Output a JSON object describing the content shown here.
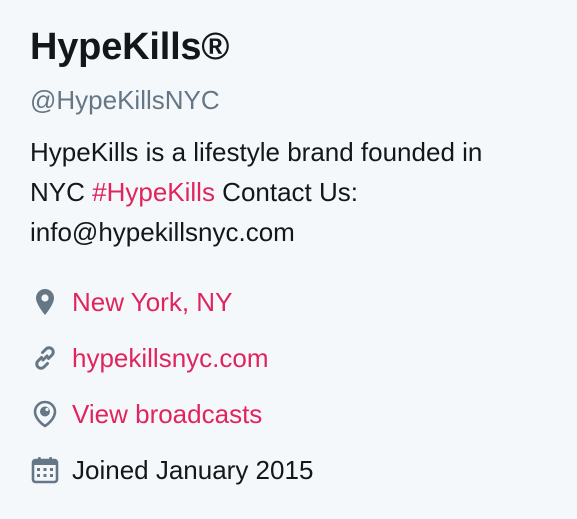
{
  "profile": {
    "display_name": "HypeKills®",
    "handle": "@HypeKillsNYC",
    "bio": {
      "line1": "HypeKills is a lifestyle brand founded in",
      "nyc_prefix": "NYC ",
      "hashtag": "#HypeKills",
      "contact": " Contact Us:",
      "email": "info@hypekillsnyc.com"
    },
    "location": "New York, NY",
    "website": "hypekillsnyc.com",
    "broadcasts": "View broadcasts",
    "joined": "Joined January 2015"
  },
  "icons": {
    "location": "map-pin-icon",
    "website": "link-icon",
    "broadcasts": "periscope-icon",
    "joined": "calendar-icon"
  },
  "colors": {
    "accent": "#e0245e",
    "text": "#14171a",
    "muted": "#657786",
    "icon": "#657786",
    "background": "#f5f8fa"
  }
}
